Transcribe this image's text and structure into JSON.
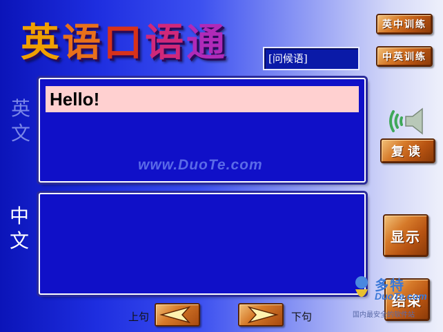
{
  "app": {
    "title_chars": [
      "英",
      "语",
      "口",
      "语",
      "通"
    ],
    "lesson_box": "[问候语]"
  },
  "buttons": {
    "en_to_cn": "英中训练",
    "cn_to_en": "中英训练",
    "repeat": "复读",
    "show": "显示",
    "end": "结束"
  },
  "labels": {
    "english": "英文",
    "chinese": "中文",
    "prev": "上句",
    "next": "下句"
  },
  "content": {
    "english_sentence": "Hello!",
    "chinese_sentence": ""
  },
  "watermark": "www.DuoTe.com",
  "logo": {
    "cn": "多特",
    "en": "DuoTe.com",
    "sub": "国内最安全的软件站"
  },
  "icons": {
    "speaker": "speaker-icon",
    "prev_arrow": "arrow-left-icon",
    "next_arrow": "arrow-right-icon"
  },
  "colors": {
    "panel_bg": "#1010c8",
    "highlight": "#ffd0d0",
    "wood": "#d67a2a"
  }
}
